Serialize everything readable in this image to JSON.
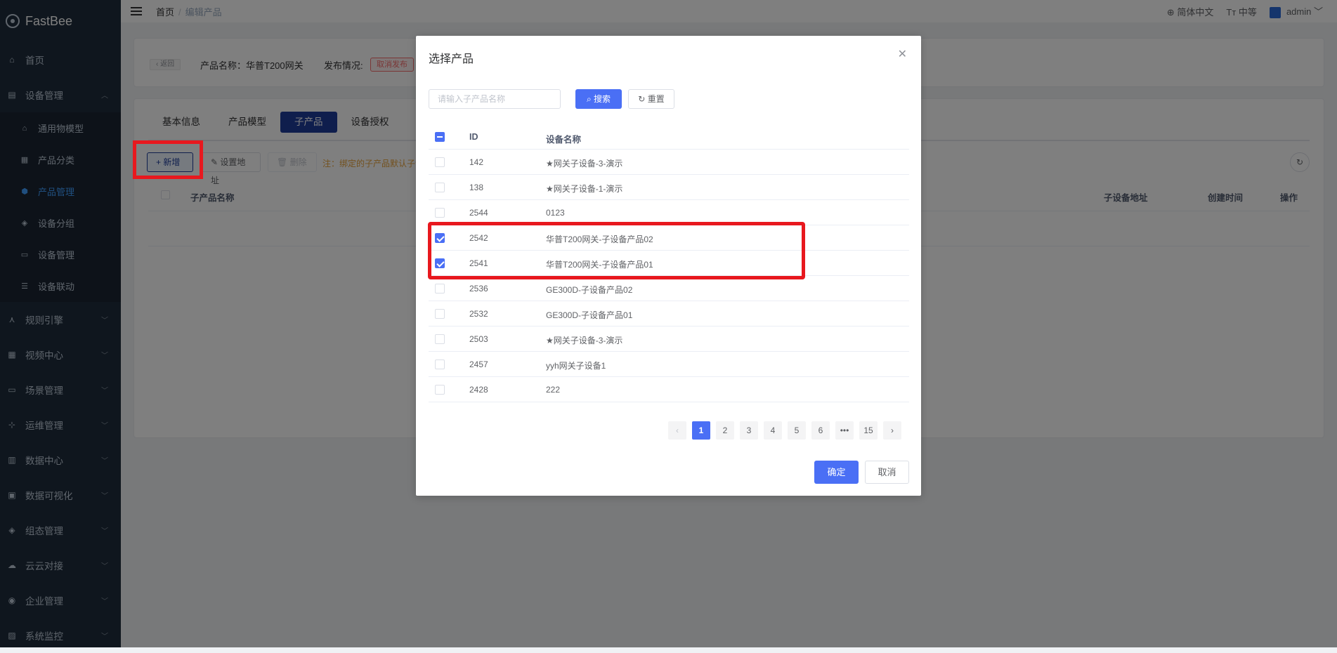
{
  "app": {
    "name": "FastBee"
  },
  "sidebar": {
    "items": [
      {
        "label": "首页",
        "icon": "home-icon"
      },
      {
        "label": "设备管理",
        "icon": "device-icon",
        "expanded": true,
        "children": [
          {
            "label": "通用物模型",
            "icon": "model-icon"
          },
          {
            "label": "产品分类",
            "icon": "category-icon"
          },
          {
            "label": "产品管理",
            "icon": "product-icon",
            "active": true
          },
          {
            "label": "设备分组",
            "icon": "group-icon"
          },
          {
            "label": "设备管理",
            "icon": "device-manage-icon"
          },
          {
            "label": "设备联动",
            "icon": "linkage-icon"
          }
        ]
      },
      {
        "label": "规则引擎",
        "icon": "rule-icon"
      },
      {
        "label": "视频中心",
        "icon": "video-icon"
      },
      {
        "label": "场景管理",
        "icon": "scene-icon"
      },
      {
        "label": "运维管理",
        "icon": "ops-icon"
      },
      {
        "label": "数据中心",
        "icon": "data-icon"
      },
      {
        "label": "数据可视化",
        "icon": "visual-icon"
      },
      {
        "label": "组态管理",
        "icon": "config-icon"
      },
      {
        "label": "云云对接",
        "icon": "cloud-icon"
      },
      {
        "label": "企业管理",
        "icon": "company-icon"
      },
      {
        "label": "系统监控",
        "icon": "monitor-icon"
      }
    ]
  },
  "header": {
    "breadcrumb": [
      "首页",
      "编辑产品"
    ],
    "language": "简体中文",
    "font_size": "中等",
    "user": "admin"
  },
  "product_info": {
    "back_label": "返回",
    "name_label": "产品名称：华普T200网关",
    "publish_label": "发布情况:",
    "publish_tag": "取消发布"
  },
  "tabs": [
    "基本信息",
    "产品模型",
    "子产品",
    "设备授权"
  ],
  "toolbar": {
    "add_label": "新增",
    "set_addr_label": "设置地址",
    "delete_label": "删除",
    "note": "注：绑定的子产品默认子设"
  },
  "sub_table": {
    "columns": [
      "子产品名称",
      "子设备地址",
      "创建时间",
      "操作"
    ]
  },
  "dialog": {
    "title": "选择产品",
    "search_placeholder": "请输入子产品名称",
    "search_label": "搜索",
    "reset_label": "重置",
    "columns": {
      "id": "ID",
      "name": "设备名称"
    },
    "rows": [
      {
        "id": "142",
        "name": "★网关子设备-3-演示",
        "checked": false
      },
      {
        "id": "138",
        "name": "★网关子设备-1-演示",
        "checked": false
      },
      {
        "id": "2544",
        "name": "0123",
        "checked": false
      },
      {
        "id": "2542",
        "name": "华普T200网关-子设备产品02",
        "checked": true
      },
      {
        "id": "2541",
        "name": "华普T200网关-子设备产品01",
        "checked": true
      },
      {
        "id": "2536",
        "name": "GE300D-子设备产品02",
        "checked": false
      },
      {
        "id": "2532",
        "name": "GE300D-子设备产品01",
        "checked": false
      },
      {
        "id": "2503",
        "name": "★网关子设备-3-演示",
        "checked": false
      },
      {
        "id": "2457",
        "name": "yyh网关子设备1",
        "checked": false
      },
      {
        "id": "2428",
        "name": "222",
        "checked": false
      }
    ],
    "pager": [
      "1",
      "2",
      "3",
      "4",
      "5",
      "6",
      "•••",
      "15"
    ],
    "current_page": "1",
    "ok_label": "确定",
    "cancel_label": "取消"
  },
  "colors": {
    "sidebar_bg": "#1f2d3d",
    "primary": "#4a6ff5",
    "active_tab": "#1f3c9b",
    "highlight": "#e8181e",
    "danger": "#f56c6c"
  }
}
